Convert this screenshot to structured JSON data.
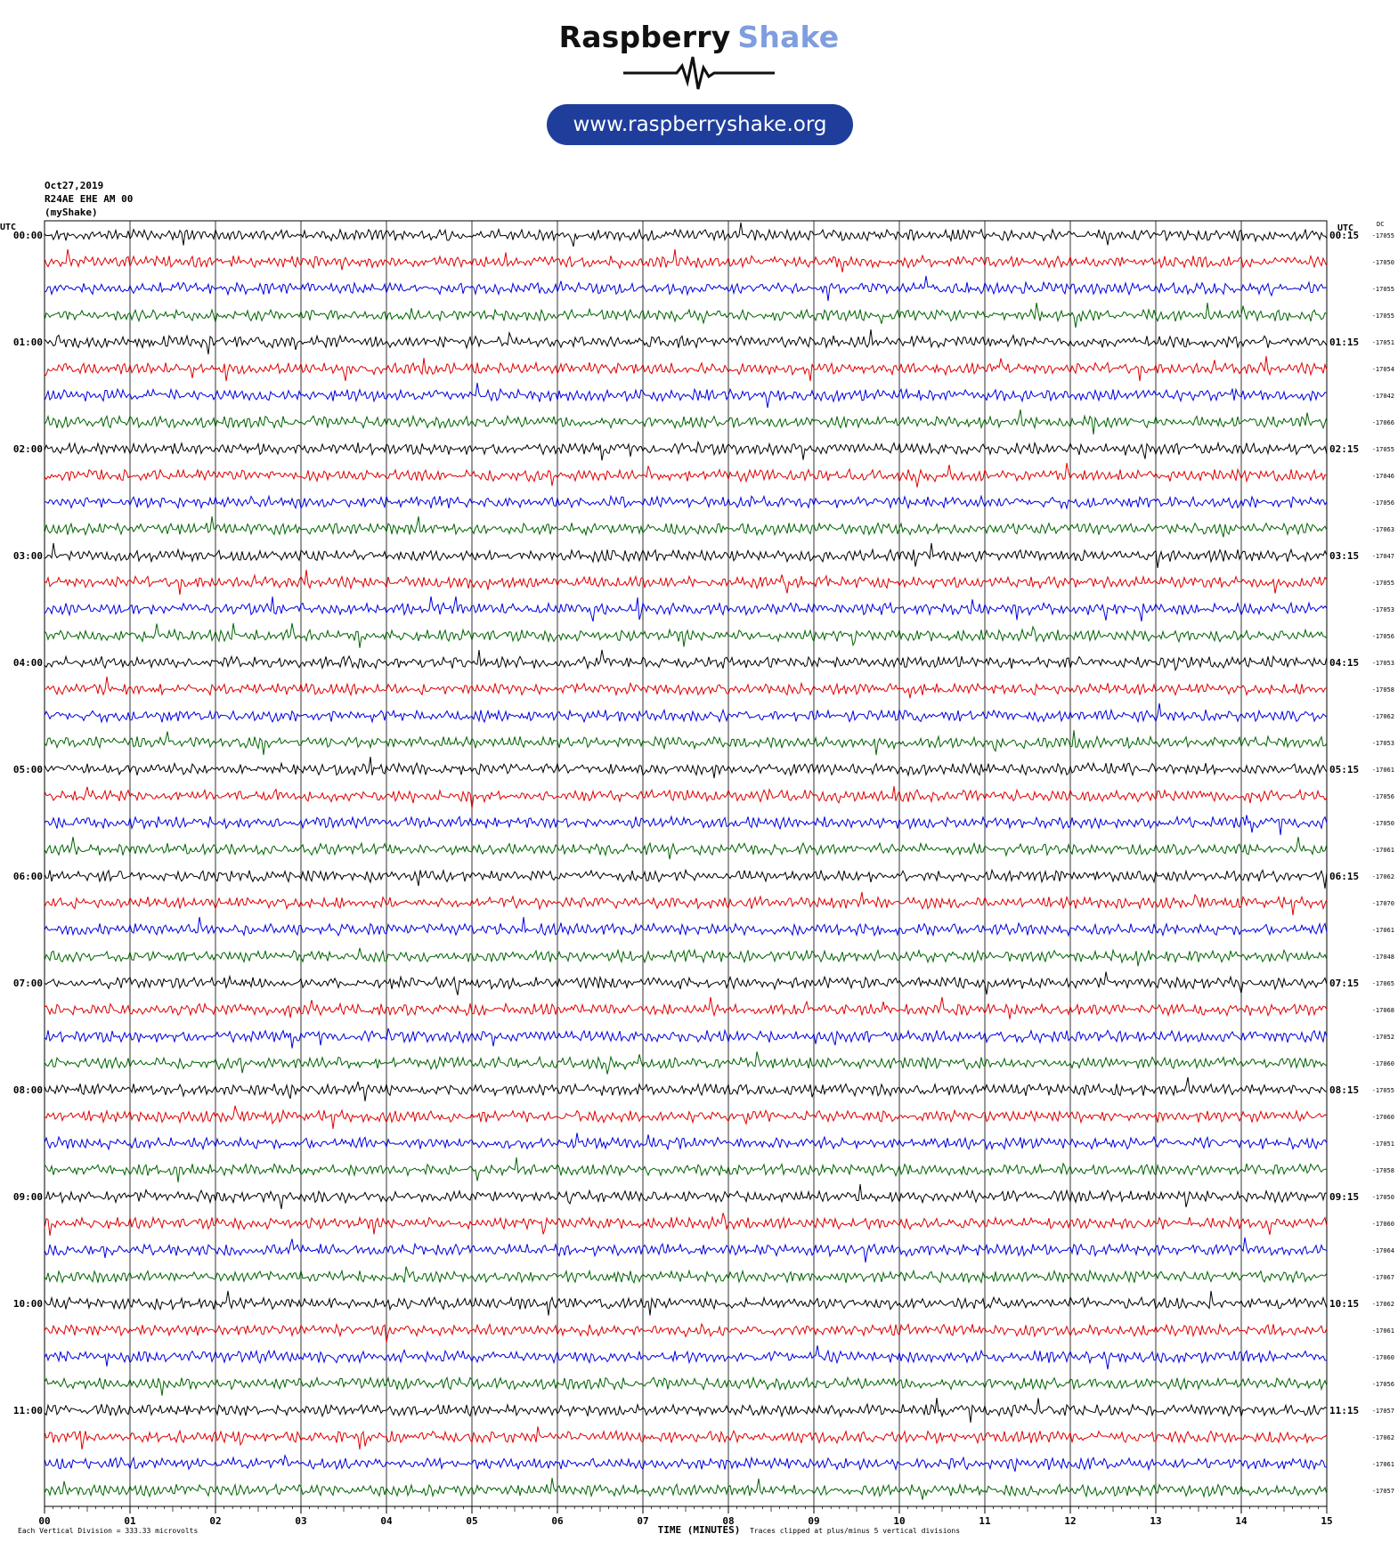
{
  "logo": {
    "word1": "Raspberry",
    "word2": "Shake",
    "url": "www.raspberryshake.org",
    "accent": "#7f9ee0",
    "pill_color": "#1f3e9c"
  },
  "header": {
    "date": "Oct27,2019",
    "station": "R24AE EHE AM 00",
    "source": "(myShake)"
  },
  "chart_data": {
    "type": "line",
    "title": "",
    "xlabel": "TIME (MINUTES)",
    "x_ticks": [
      "00",
      "01",
      "02",
      "03",
      "04",
      "05",
      "06",
      "07",
      "08",
      "09",
      "10",
      "11",
      "12",
      "13",
      "14",
      "15"
    ],
    "xlim": [
      0,
      15
    ],
    "left_axis_label": "UTC",
    "right_axis_label": "UTC",
    "dc_label": "DC",
    "row_labels_left": [
      "00:00",
      "01:00",
      "02:00",
      "03:00",
      "04:00",
      "05:00",
      "06:00",
      "07:00",
      "08:00",
      "09:00",
      "10:00",
      "11:00"
    ],
    "row_labels_right": [
      "00:15",
      "01:15",
      "02:15",
      "03:15",
      "04:15",
      "05:15",
      "06:15",
      "07:15",
      "08:15",
      "09:15",
      "10:15",
      "11:15"
    ],
    "trace_colors": [
      "#000000",
      "#e00000",
      "#0000e0",
      "#006400"
    ],
    "dc_offsets": [
      "-17055",
      "-17050",
      "-17055",
      "-17055",
      "-17051",
      "-17054",
      "-17042",
      "-17066",
      "-17055",
      "-17046",
      "-17056",
      "-17063",
      "-17047",
      "-17055",
      "-17053",
      "-17056",
      "-17053",
      "-17058",
      "-17062",
      "-17053",
      "-17061",
      "-17056",
      "-17050",
      "-17061",
      "-17062",
      "-17070",
      "-17061",
      "-17048",
      "-17065",
      "-17068",
      "-17052",
      "-17060",
      "-17055",
      "-17060",
      "-17051",
      "-17058",
      "-17050",
      "-17060",
      "-17064",
      "-17067",
      "-17062",
      "-17061",
      "-17060",
      "-17056",
      "-17057",
      "-17062",
      "-17061",
      "-17057"
    ],
    "footer_left": "Each Vertical Division =  333.33 microvolts",
    "footer_right": "Traces clipped at plus/minus 5 vertical divisions"
  }
}
